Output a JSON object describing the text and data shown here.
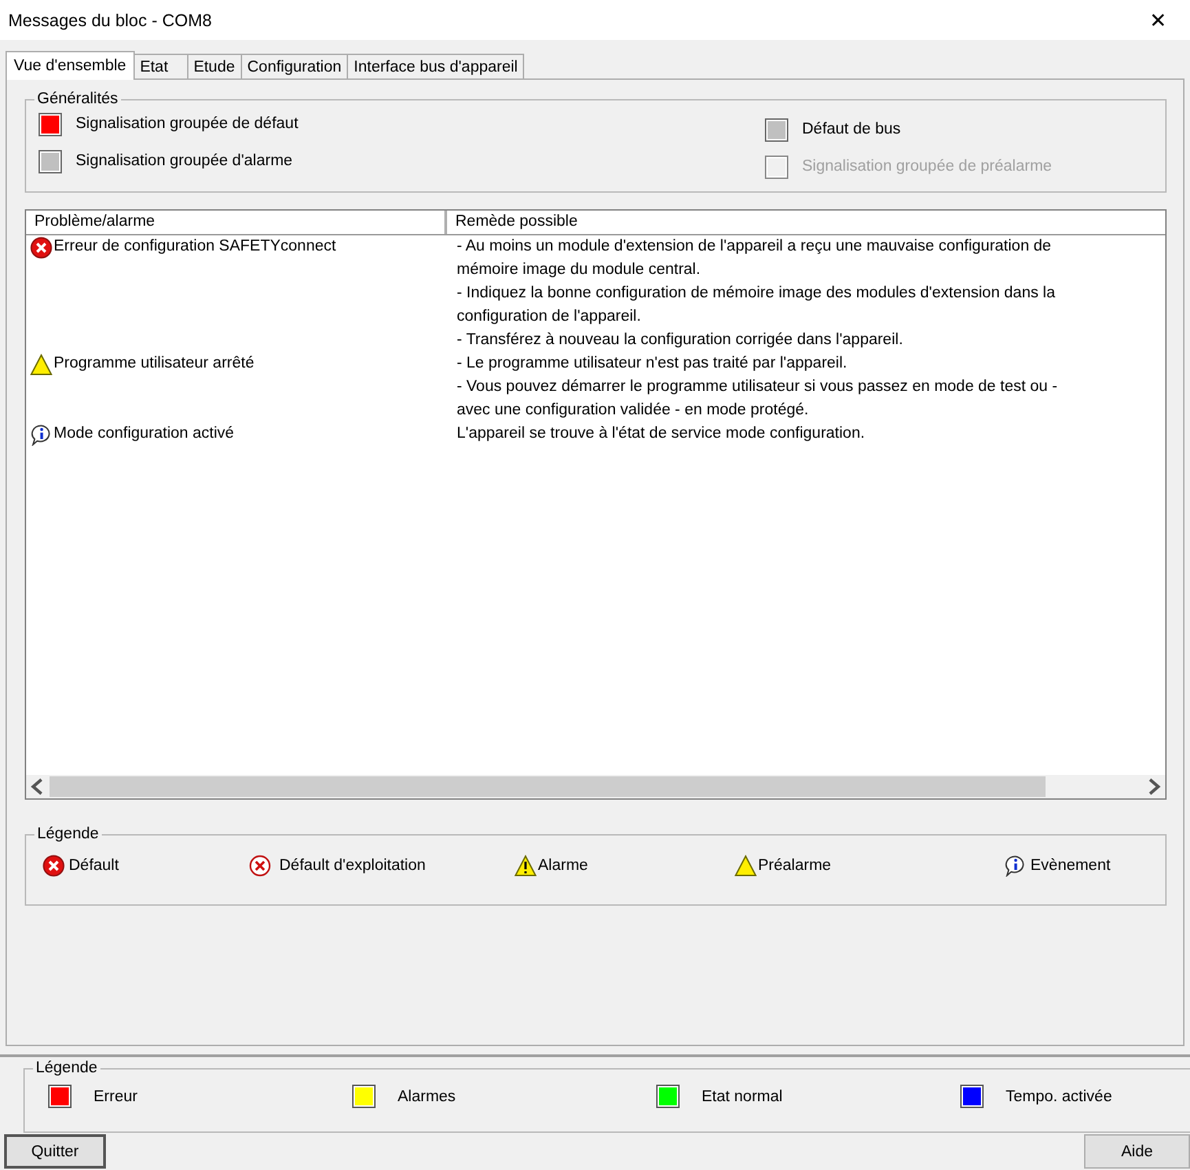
{
  "window": {
    "title": "Messages du bloc - COM8",
    "close": "✕"
  },
  "tabs": [
    {
      "label": "Vue d'ensemble",
      "selected": true
    },
    {
      "label": "Etat",
      "selected": false
    },
    {
      "label": "Etude",
      "selected": false
    },
    {
      "label": "Configuration",
      "selected": false
    },
    {
      "label": "Interface bus d'appareil",
      "selected": false
    }
  ],
  "general": {
    "title": "Généralités",
    "indicators": [
      {
        "label": "Signalisation groupée de défaut",
        "color": "#ff0000",
        "disabled": false
      },
      {
        "label": "Défaut de bus",
        "color": "#c0c0c0",
        "disabled": false
      },
      {
        "label": "Signalisation groupée d'alarme",
        "color": "#c0c0c0",
        "disabled": false
      },
      {
        "label": "Signalisation groupée de préalarme",
        "color": "#f0f0f0",
        "disabled": true
      }
    ]
  },
  "table": {
    "columns": [
      "Problème/alarme",
      "Remède possible"
    ],
    "rows": [
      {
        "kind": "error",
        "problem": "Erreur de configuration SAFETYconnect",
        "remedy": [
          "- Au moins un module d'extension de l'appareil a reçu une mauvaise configuration de",
          "mémoire image du module central.",
          "- Indiquez la bonne configuration de mémoire image des modules d'extension dans la",
          "configuration de l'appareil.",
          "- Transférez à nouveau la configuration corrigée dans l'appareil."
        ]
      },
      {
        "kind": "alarm-plain",
        "problem": "Programme utilisateur arrêté",
        "remedy": [
          "- Le programme utilisateur n'est pas traité par l'appareil.",
          "- Vous pouvez démarrer le programme utilisateur si vous passez en mode de test ou -",
          "avec une configuration validée - en mode protégé."
        ]
      },
      {
        "kind": "event",
        "problem": "Mode configuration activé",
        "remedy": [
          "L'appareil se trouve à l'état de service mode configuration."
        ]
      }
    ]
  },
  "legend": {
    "title": "Légende",
    "items": [
      {
        "kind": "error",
        "label": "Défault"
      },
      {
        "kind": "operating-error",
        "label": "Défault d'exploitation"
      },
      {
        "kind": "alarm",
        "label": "Alarme"
      },
      {
        "kind": "alarm-plain",
        "label": "Préalarme"
      },
      {
        "kind": "event",
        "label": "Evènement"
      }
    ]
  },
  "color_legend": {
    "title": "Légende",
    "items": [
      {
        "label": "Erreur",
        "color": "#ff0000"
      },
      {
        "label": "Alarmes",
        "color": "#ffff00"
      },
      {
        "label": "Etat normal",
        "color": "#00ff00"
      },
      {
        "label": "Tempo. activée",
        "color": "#0000ff"
      }
    ]
  },
  "buttons": {
    "quit": "Quitter",
    "help": "Aide"
  }
}
